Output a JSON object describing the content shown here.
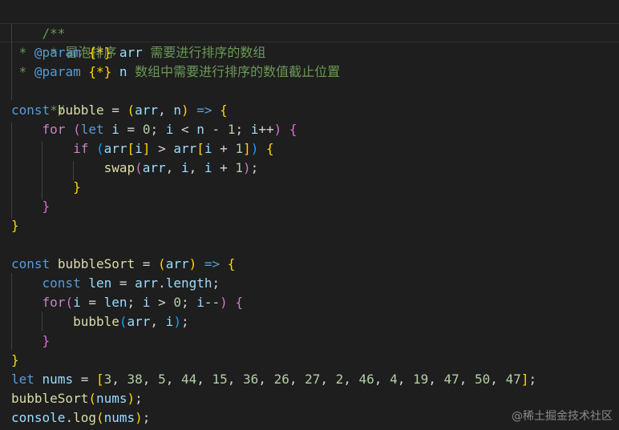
{
  "code": {
    "comment": {
      "open": "/**",
      "line1": " * 冒泡排序",
      "p1_star": " * ",
      "p1_tag": "@param",
      "p1_type": " {*} ",
      "p1_name": "arr",
      "p1_desc": " 需要进行排序的数组",
      "p2_star": " * ",
      "p2_tag": "@param",
      "p2_type": " {*} ",
      "p2_name": "n",
      "p2_desc": " 数组中需要进行排序的数值截止位置",
      "close": " */"
    },
    "bubble": {
      "decl": "const",
      "name": "bubble",
      "param1": "arr",
      "param2": "n",
      "loop_kw": "for",
      "let_kw": "let",
      "loop_var": "i",
      "zero": "0",
      "one": "1",
      "if_kw": "if",
      "arr": "arr",
      "swap": "swap"
    },
    "bubbleSort": {
      "decl": "const",
      "name": "bubbleSort",
      "param": "arr",
      "len_decl": "const",
      "len_var": "len",
      "length_prop": "length",
      "loop_kw": "for",
      "zero": "0",
      "call_name": "bubble"
    },
    "nums": {
      "decl": "let",
      "name": "nums",
      "values": [
        "3",
        "38",
        "5",
        "44",
        "15",
        "36",
        "26",
        "27",
        "2",
        "46",
        "4",
        "19",
        "47",
        "50",
        "47"
      ]
    },
    "calls": {
      "sort_call": "bubbleSort",
      "console": "console",
      "log": "log",
      "arg": "nums"
    }
  },
  "watermark": "@稀土掘金技术社区"
}
